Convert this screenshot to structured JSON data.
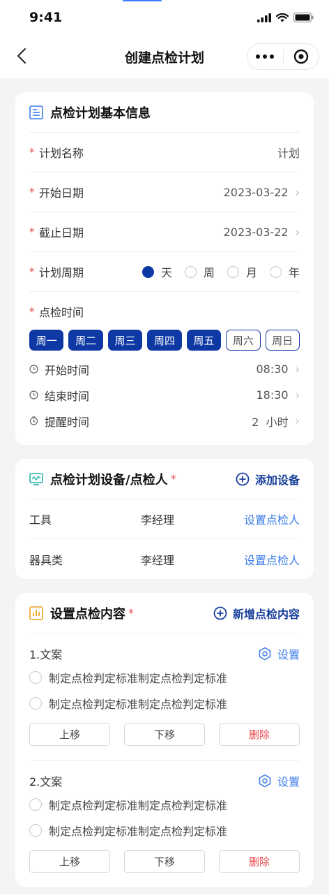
{
  "status_bar": {
    "time": "9:41"
  },
  "nav": {
    "title": "创建点检计划"
  },
  "basic_info": {
    "title": "点检计划基本信息",
    "plan_name": {
      "label": "计划名称",
      "value": "计划"
    },
    "start_date": {
      "label": "开始日期",
      "value": "2023-03-22"
    },
    "end_date": {
      "label": "截止日期",
      "value": "2023-03-22"
    },
    "cycle": {
      "label": "计划周期",
      "options": [
        "天",
        "周",
        "月",
        "年"
      ],
      "selected": "天"
    },
    "inspection_time": {
      "label": "点检时间",
      "days": [
        {
          "label": "周一",
          "selected": true
        },
        {
          "label": "周二",
          "selected": true
        },
        {
          "label": "周三",
          "selected": true
        },
        {
          "label": "周四",
          "selected": true
        },
        {
          "label": "周五",
          "selected": true
        },
        {
          "label": "周六",
          "selected": false
        },
        {
          "label": "周日",
          "selected": false
        }
      ]
    },
    "start_time": {
      "label": "开始时间",
      "value": "08:30"
    },
    "end_time": {
      "label": "结束时间",
      "value": "18:30"
    },
    "remind_time": {
      "label": "提醒时间",
      "value": "2  小时"
    }
  },
  "devices": {
    "title": "点检计划设备/点检人",
    "required_mark": "*",
    "add_label": "添加设备",
    "rows": [
      {
        "name": "工具",
        "person": "李经理",
        "action": "设置点检人"
      },
      {
        "name": "器具类",
        "person": "李经理",
        "action": "设置点检人"
      }
    ]
  },
  "content": {
    "title": "设置点检内容",
    "required_mark": "*",
    "add_label": "新增点检内容",
    "sections": [
      {
        "title": "1.文案",
        "settings_label": "设置",
        "options": [
          "制定点检判定标准制定点检判定标准",
          "制定点检判定标准制定点检判定标准"
        ],
        "buttons": {
          "up": "上移",
          "down": "下移",
          "delete": "删除"
        }
      },
      {
        "title": "2.文案",
        "settings_label": "设置",
        "options": [
          "制定点检判定标准制定点检判定标准",
          "制定点检判定标准制定点检判定标准"
        ],
        "buttons": {
          "up": "上移",
          "down": "下移",
          "delete": "删除"
        }
      }
    ]
  },
  "colors": {
    "primary": "#0e39a5",
    "link": "#3b7be8",
    "required": "#e5484d",
    "background": "#f3f4f6"
  },
  "icons": [
    "back-arrow-icon",
    "more-dots-icon",
    "target-icon",
    "document-icon",
    "monitor-icon",
    "chart-icon",
    "plus-circle-icon",
    "settings-hex-icon",
    "clock-icon",
    "alarm-icon",
    "chevron-right-icon"
  ]
}
